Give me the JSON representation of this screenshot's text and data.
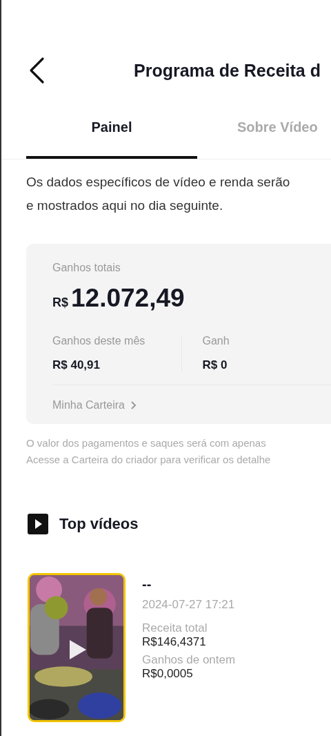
{
  "header": {
    "title": "Programa de Receita d"
  },
  "tabs": [
    {
      "label": "Painel",
      "selected": true
    },
    {
      "label": "Sobre Vídeo",
      "selected": false
    }
  ],
  "notice": [
    "Os dados específicos de vídeo e renda serão",
    "e mostrados aqui no dia seguinte."
  ],
  "earnings_card": {
    "total_label": "Ganhos totais",
    "currency": "R$",
    "total_value": "12.072,49",
    "stats": [
      {
        "label": "Ganhos deste mês",
        "value": "R$ 40,91"
      },
      {
        "label": "Ganh",
        "value": "R$ 0"
      }
    ],
    "wallet_link": "Minha Carteira"
  },
  "footnote": [
    "O valor dos pagamentos e saques será com apenas",
    "Acesse a Carteira do criador para verificar os detalhe"
  ],
  "top_videos": {
    "title": "Top vídeos",
    "videos": [
      {
        "title": "--",
        "date": "2024-07-27 17:21",
        "metrics": [
          {
            "label": "Receita total",
            "value": "R$146,4371"
          },
          {
            "label": "Ganhos de ontem",
            "value": "R$0,0005"
          }
        ]
      }
    ]
  }
}
